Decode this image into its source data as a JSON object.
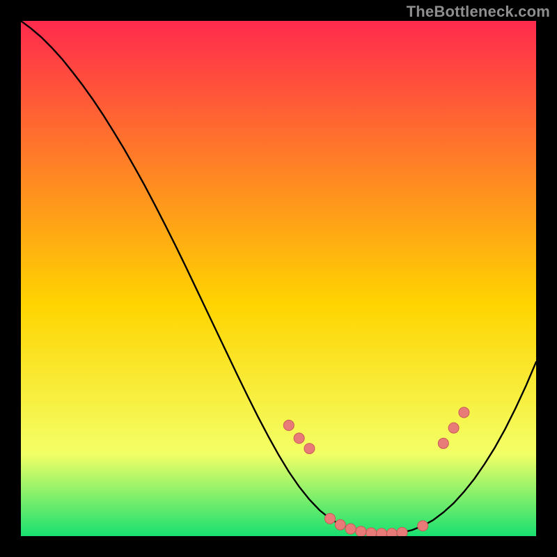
{
  "attribution": "TheBottleneck.com",
  "colors": {
    "page_bg": "#000000",
    "gradient_top": "#ff2a4d",
    "gradient_mid": "#ffd400",
    "gradient_low": "#f3ff66",
    "gradient_bottom": "#18e070",
    "curve": "#000000",
    "marker_fill": "#e87b78",
    "marker_stroke": "#c85a57"
  },
  "chart_data": {
    "type": "line",
    "title": "",
    "xlabel": "",
    "ylabel": "",
    "xlim": [
      0,
      100
    ],
    "ylim": [
      0,
      100
    ],
    "series": [
      {
        "name": "bottleneck-curve",
        "x": [
          0,
          2,
          4,
          6,
          8,
          10,
          12,
          14,
          16,
          18,
          20,
          22,
          24,
          26,
          28,
          30,
          32,
          34,
          36,
          38,
          40,
          42,
          44,
          46,
          48,
          50,
          52,
          54,
          56,
          58,
          60,
          62,
          64,
          66,
          68,
          70,
          72,
          74,
          76,
          78,
          80,
          82,
          84,
          86,
          88,
          90,
          92,
          94,
          96,
          98,
          100
        ],
        "values": [
          100,
          98.5,
          96.8,
          94.8,
          92.6,
          90.1,
          87.5,
          84.7,
          81.7,
          78.5,
          75.2,
          71.7,
          68.1,
          64.3,
          60.4,
          56.4,
          52.3,
          48.1,
          43.9,
          39.7,
          35.5,
          31.3,
          27.2,
          23.2,
          19.4,
          15.8,
          12.5,
          9.6,
          7.1,
          5.0,
          3.4,
          2.2,
          1.4,
          0.9,
          0.6,
          0.5,
          0.5,
          0.7,
          1.2,
          2.0,
          3.1,
          4.6,
          6.4,
          8.6,
          11.1,
          14.0,
          17.2,
          20.8,
          24.8,
          29.1,
          33.8
        ]
      }
    ],
    "markers": {
      "name": "highlighted-points",
      "x": [
        52,
        54,
        56,
        60,
        62,
        64,
        66,
        68,
        70,
        72,
        74,
        78,
        82,
        84,
        86
      ],
      "values": [
        21.5,
        19,
        17,
        3.4,
        2.2,
        1.4,
        0.9,
        0.6,
        0.5,
        0.5,
        0.7,
        2.0,
        18,
        21,
        24
      ]
    }
  }
}
